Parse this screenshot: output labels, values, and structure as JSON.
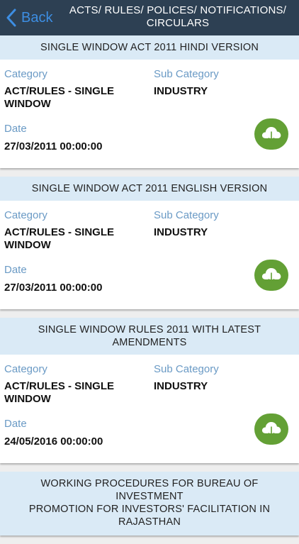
{
  "header": {
    "back_label": "Back",
    "title_line1": "ACTS/ RULES/ POLICES/ NOTIFICATIONS/",
    "title_line2": "CIRCULARS"
  },
  "labels": {
    "category": "Category",
    "sub_category": "Sub Category",
    "date": "Date"
  },
  "items": [
    {
      "title": "SINGLE WINDOW ACT 2011 HINDI VERSION",
      "category_line1": "ACT/RULES - SINGLE",
      "category_line2": "WINDOW",
      "sub_category": "INDUSTRY",
      "date": "27/03/2011 00:00:00"
    },
    {
      "title": "SINGLE WINDOW ACT 2011 ENGLISH VERSION",
      "category_line1": "ACT/RULES - SINGLE",
      "category_line2": "WINDOW",
      "sub_category": "INDUSTRY",
      "date": "27/03/2011 00:00:00"
    },
    {
      "title_line1": "SINGLE WINDOW RULES 2011 WITH LATEST",
      "title_line2": "AMENDMENTS",
      "category_line1": "ACT/RULES - SINGLE",
      "category_line2": "WINDOW",
      "sub_category": "INDUSTRY",
      "date": "24/05/2016 00:00:00"
    },
    {
      "title_line1": "WORKING PROCEDURES FOR BUREAU OF INVESTMENT",
      "title_line2": "PROMOTION FOR INVESTORS' FACILITATION IN",
      "title_line3": "RAJASTHAN"
    }
  ],
  "colors": {
    "header_bg": "#2d4053",
    "back_blue": "#3d8ee3",
    "title_bar": "#daeaf6",
    "label_blue": "#6a9ac5",
    "download_green": "#63a035"
  },
  "icons": {
    "back": "chevron-left-icon",
    "download": "cloud-download-icon"
  }
}
